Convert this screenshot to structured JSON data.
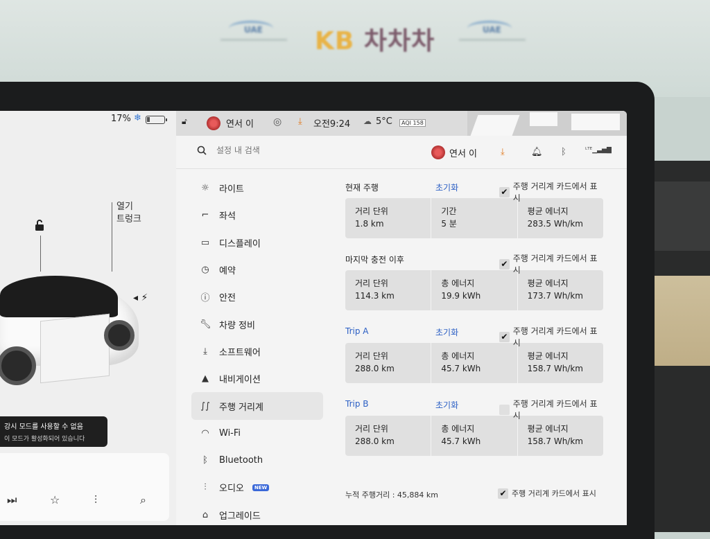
{
  "banner": {
    "brand_main": "KB",
    "brand_sub": "차차차",
    "logo_text": "UAE"
  },
  "car_panel": {
    "battery_percent_label": "17%",
    "battery_level": 0.17,
    "trunk_label_line1": "열기",
    "trunk_label_line2": "트렁크",
    "toast_line1": "강시 모드를 사용할 수 없음",
    "toast_line2": "이 모드가 활성화되어 있습니다"
  },
  "top_status": {
    "user_name": "연서 이",
    "time": "오전9:24",
    "temperature": "5°C",
    "aqi": "AQI 158"
  },
  "settings": {
    "search_placeholder": "설정 내 검색",
    "header_user": "연서 이",
    "menu": [
      {
        "label": "라이트",
        "icon": "sun-icon"
      },
      {
        "label": "좌석",
        "icon": "seat-icon"
      },
      {
        "label": "디스플레이",
        "icon": "display-icon"
      },
      {
        "label": "예약",
        "icon": "clock-icon"
      },
      {
        "label": "안전",
        "icon": "safety-icon"
      },
      {
        "label": "차량 정비",
        "icon": "wrench-icon"
      },
      {
        "label": "소프트웨어",
        "icon": "download-icon"
      },
      {
        "label": "내비게이션",
        "icon": "navigation-icon"
      },
      {
        "label": "주행 거리계",
        "icon": "trips-icon",
        "active": true
      },
      {
        "label": "Wi-Fi",
        "icon": "wifi-icon"
      },
      {
        "label": "Bluetooth",
        "icon": "bluetooth-icon"
      },
      {
        "label": "오디오",
        "icon": "audio-icon",
        "badge": "NEW"
      },
      {
        "label": "업그레이드",
        "icon": "lock-icon"
      }
    ],
    "sections": [
      {
        "title": "현재 주행",
        "reset": "초기화",
        "blue_title": false,
        "show_label": "주행 거리계 카드에서 표시",
        "checked": true,
        "cells": [
          {
            "label": "거리 단위",
            "value": "1.8 km"
          },
          {
            "label": "기간",
            "value": "5 분"
          },
          {
            "label": "평균 에너지",
            "value": "283.5 Wh/km"
          }
        ]
      },
      {
        "title": "마지막 충전 이후",
        "reset": "",
        "blue_title": false,
        "show_label": "주행 거리계 카드에서 표시",
        "checked": true,
        "cells": [
          {
            "label": "거리 단위",
            "value": "114.3 km"
          },
          {
            "label": "총 에너지",
            "value": "19.9 kWh"
          },
          {
            "label": "평균 에너지",
            "value": "173.7 Wh/km"
          }
        ]
      },
      {
        "title": "Trip A",
        "reset": "초기화",
        "blue_title": true,
        "show_label": "주행 거리계 카드에서 표시",
        "checked": true,
        "cells": [
          {
            "label": "거리 단위",
            "value": "288.0 km"
          },
          {
            "label": "총 에너지",
            "value": "45.7 kWh"
          },
          {
            "label": "평균 에너지",
            "value": "158.7 Wh/km"
          }
        ]
      },
      {
        "title": "Trip B",
        "reset": "초기화",
        "blue_title": true,
        "show_label": "주행 거리계 카드에서 표시",
        "checked": false,
        "cells": [
          {
            "label": "거리 단위",
            "value": "288.0 km"
          },
          {
            "label": "총 에너지",
            "value": "45.7 kWh"
          },
          {
            "label": "평균 에너지",
            "value": "158.7 Wh/km"
          }
        ]
      }
    ],
    "odometer_label": "누적 주행거리 : 45,884 km",
    "odometer_show_label": "주행 거리계 카드에서 표시",
    "odometer_checked": true
  },
  "colors": {
    "accent_blue": "#2a5ec4",
    "download_orange": "#e0781d"
  }
}
